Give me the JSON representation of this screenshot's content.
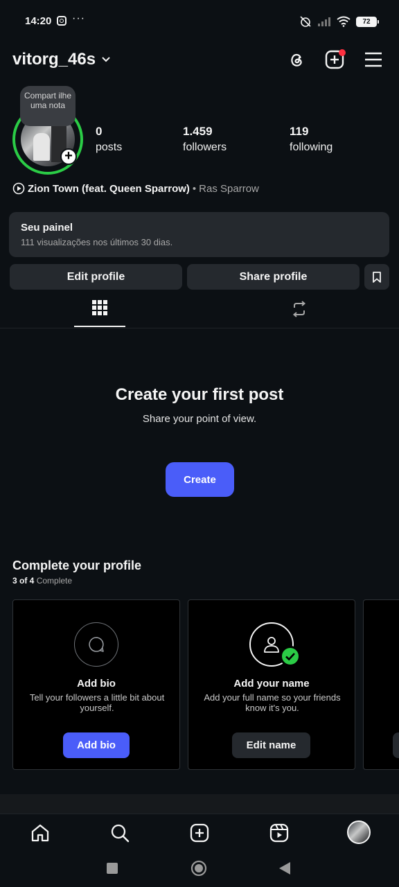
{
  "status_bar": {
    "time": "14:20",
    "dots": "···",
    "battery": "72"
  },
  "header": {
    "username": "vitorg_46s"
  },
  "profile": {
    "note_bubble": "Compart ilhe uma nota",
    "stats": [
      {
        "value": "0",
        "label": "posts"
      },
      {
        "value": "1.459",
        "label": "followers"
      },
      {
        "value": "119",
        "label": "following"
      }
    ],
    "music": {
      "title": "Zion Town (feat. Queen Sparrow)",
      "separator": "•",
      "artist": "Ras Sparrow"
    }
  },
  "dashboard": {
    "title": "Seu painel",
    "subtitle": "111 visualizações nos últimos 30 dias."
  },
  "actions": {
    "edit": "Edit profile",
    "share": "Share profile"
  },
  "empty_state": {
    "title": "Create your first post",
    "subtitle": "Share your point of view.",
    "button": "Create"
  },
  "complete_profile": {
    "title": "Complete your profile",
    "progress": "3 of 4",
    "progress_suffix": "Complete",
    "cards": [
      {
        "icon": "speech-bubble-icon",
        "title": "Add bio",
        "desc": "Tell your followers a little bit about yourself.",
        "button": "Add bio",
        "done": false
      },
      {
        "icon": "person-icon",
        "title": "Add your name",
        "desc": "Add your full name so your friends know it's you.",
        "button": "Edit name",
        "done": true
      }
    ]
  },
  "colors": {
    "accent": "#4a5df9",
    "story_ring": "#2bcc46",
    "notification": "#ff3040",
    "check": "#2bcc46"
  }
}
